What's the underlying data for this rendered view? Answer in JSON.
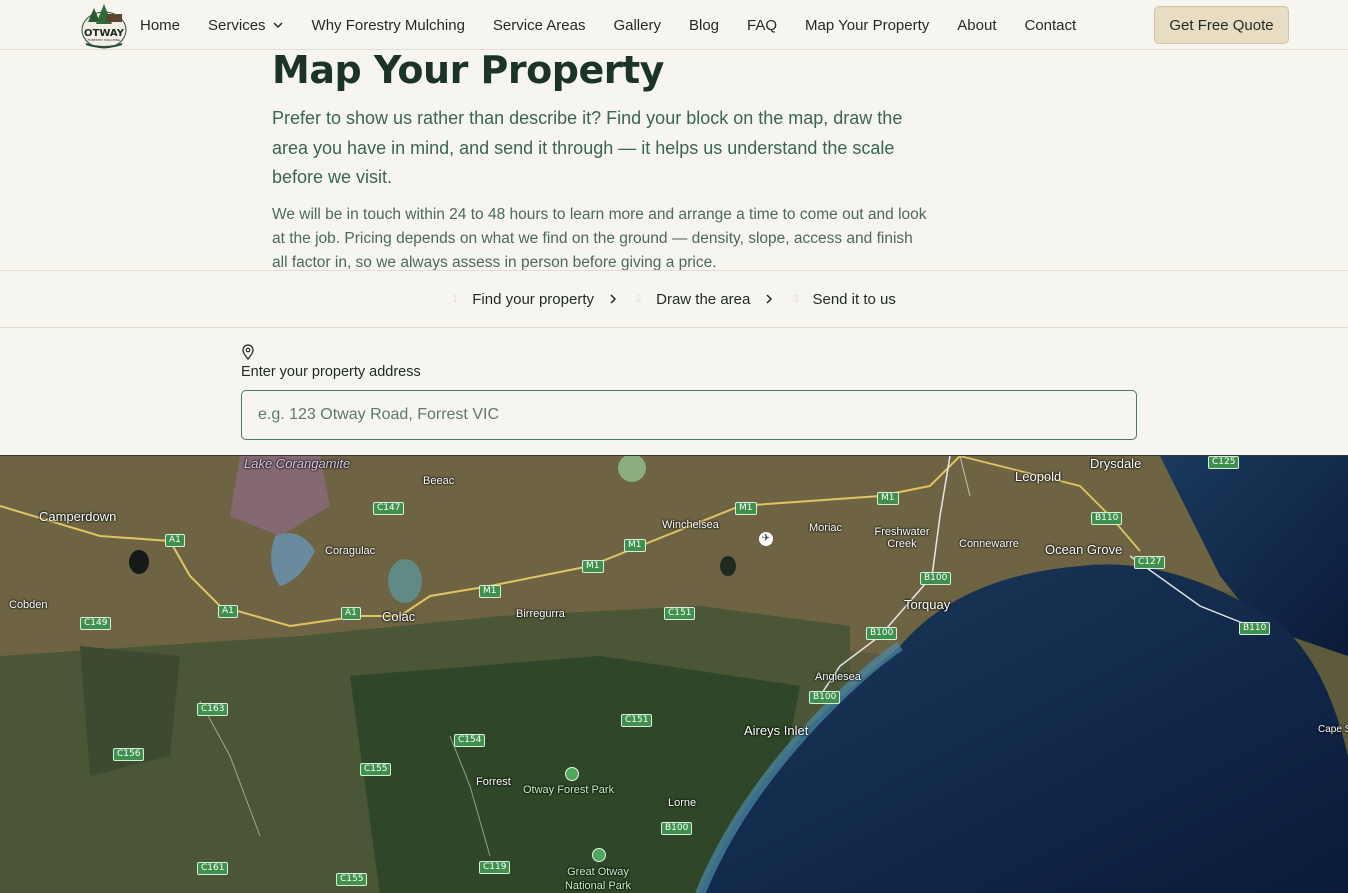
{
  "nav": {
    "logo_text": "OTWAY",
    "logo_sub": "FORESTRY MULCHING",
    "links": [
      {
        "label": "Home"
      },
      {
        "label": "Services",
        "has_dropdown": true
      },
      {
        "label": "Why Forestry Mulching"
      },
      {
        "label": "Service Areas"
      },
      {
        "label": "Gallery"
      },
      {
        "label": "Blog"
      },
      {
        "label": "FAQ"
      },
      {
        "label": "Map Your Property"
      },
      {
        "label": "About"
      },
      {
        "label": "Contact"
      }
    ],
    "cta_label": "Get Free Quote"
  },
  "hero": {
    "title": "Map Your Property",
    "lead": "Prefer to show us rather than describe it? Find your block on the map, draw the area you have in mind, and send it through — it helps us understand the scale before we visit.",
    "sub": "We will be in touch within 24 to 48 hours to learn more and arrange a time to come out and look at the job. Pricing depends on what we find on the ground — density, slope, access and finish all factor in, so we always assess in person before giving a price."
  },
  "steps": [
    {
      "num": "1",
      "label": "Find your property"
    },
    {
      "num": "2",
      "label": "Draw the area"
    },
    {
      "num": "3",
      "label": "Send it to us"
    }
  ],
  "address": {
    "icon": "map-pin-icon",
    "label": "Enter your property address",
    "placeholder": "e.g. 123 Otway Road, Forrest VIC",
    "value": ""
  },
  "map": {
    "places": [
      "Lake Corangamite",
      "Beeac",
      "Camperdown",
      "Coragulac",
      "Cobden",
      "Colac",
      "Birregurra",
      "Winchelsea",
      "Moriac",
      "Freshwater Creek",
      "Connewarre",
      "Leopold",
      "Drysdale",
      "Ocean Grove",
      "Torquay",
      "Anglesea",
      "Aireys Inlet",
      "Forrest",
      "Otway Forest Park",
      "Lorne",
      "Great Otway National Park",
      "Cape Sc"
    ],
    "roads": [
      "A1",
      "A1",
      "A1",
      "C147",
      "C149",
      "M1",
      "M1",
      "M1",
      "M1",
      "M1",
      "C151",
      "C151",
      "B100",
      "B100",
      "B100",
      "B100",
      "B110",
      "B110",
      "C125",
      "C127",
      "C163",
      "C156",
      "C154",
      "C155",
      "C161",
      "C155",
      "C119"
    ]
  }
}
